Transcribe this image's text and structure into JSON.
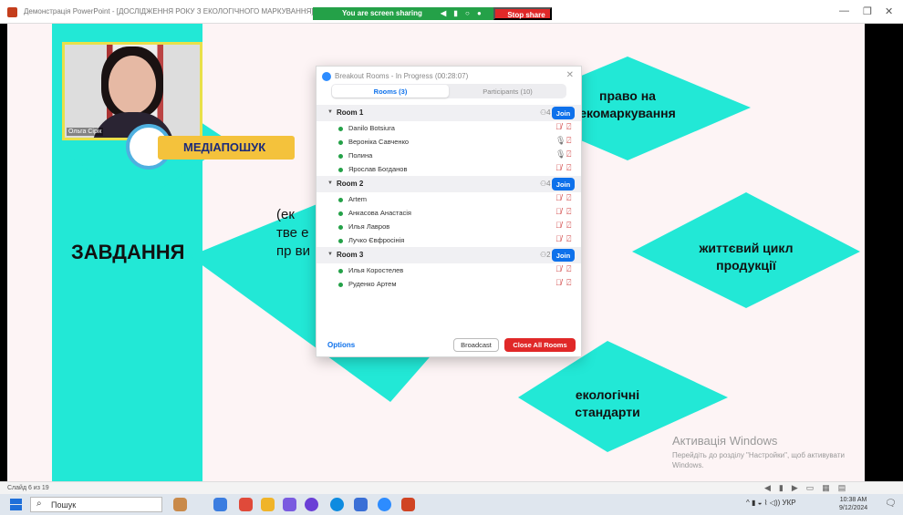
{
  "window": {
    "title": "Демонстрація PowerPoint - [ДОСЛІДЖЕННЯ РОКУ З ЕКОЛОГІЧНОГО МАРКУВАННЯ]",
    "share_status": "You are screen sharing",
    "stop_share": "Stop share"
  },
  "slide": {
    "task_label": "ЗАВДАННЯ",
    "media_label": "МЕДІАПОШУК",
    "diamond_top": "право на екомаркування",
    "diamond_right": "життєвий цикл продукції",
    "diamond_bottom": "екологічні стандарти",
    "partial_text": "(ек тве е пр ви",
    "camera_name": "Ольга Сірік",
    "activation_title": "Активація Windows",
    "activation_sub": "Перейдіть до розділу \"Настройки\", щоб активувати Windows."
  },
  "dialog": {
    "title": "Breakout Rooms - In Progress (00:28:07)",
    "tab_rooms": "Rooms (3)",
    "tab_participants": "Participants (10)",
    "rooms": [
      {
        "name": "Room 1",
        "count": "4",
        "join": "Join",
        "members": [
          {
            "name": "Danilo Botsiura",
            "mic": "muted"
          },
          {
            "name": "Вероніка Савченко",
            "mic": "on"
          },
          {
            "name": "Полина",
            "mic": "on"
          },
          {
            "name": "Ярослав Богданов",
            "mic": "muted"
          }
        ]
      },
      {
        "name": "Room 2",
        "count": "4",
        "join": "Join",
        "members": [
          {
            "name": "Artem",
            "mic": "muted"
          },
          {
            "name": "Анкасова Анастасія",
            "mic": "muted"
          },
          {
            "name": "Илья Лавров",
            "mic": "muted"
          },
          {
            "name": "Лучко Євфросінія",
            "mic": "muted"
          }
        ]
      },
      {
        "name": "Room 3",
        "count": "2",
        "join": "Join",
        "members": [
          {
            "name": "Илья Коростелев",
            "mic": "muted"
          },
          {
            "name": "Руденко Артем",
            "mic": "muted"
          }
        ]
      }
    ],
    "options": "Options",
    "broadcast": "Broadcast",
    "close_all": "Close All Rooms"
  },
  "statusbar": {
    "slide_count": "Слайд 6 из 19"
  },
  "taskbar": {
    "search_label": "Пошук",
    "language": "УКР",
    "time": "10:38 AM",
    "date": "9/12/2024"
  },
  "colors": {
    "accent_teal": "#22e8d6",
    "zoom_blue": "#0e71eb",
    "stop_red": "#e02828",
    "share_green": "#24a148"
  }
}
